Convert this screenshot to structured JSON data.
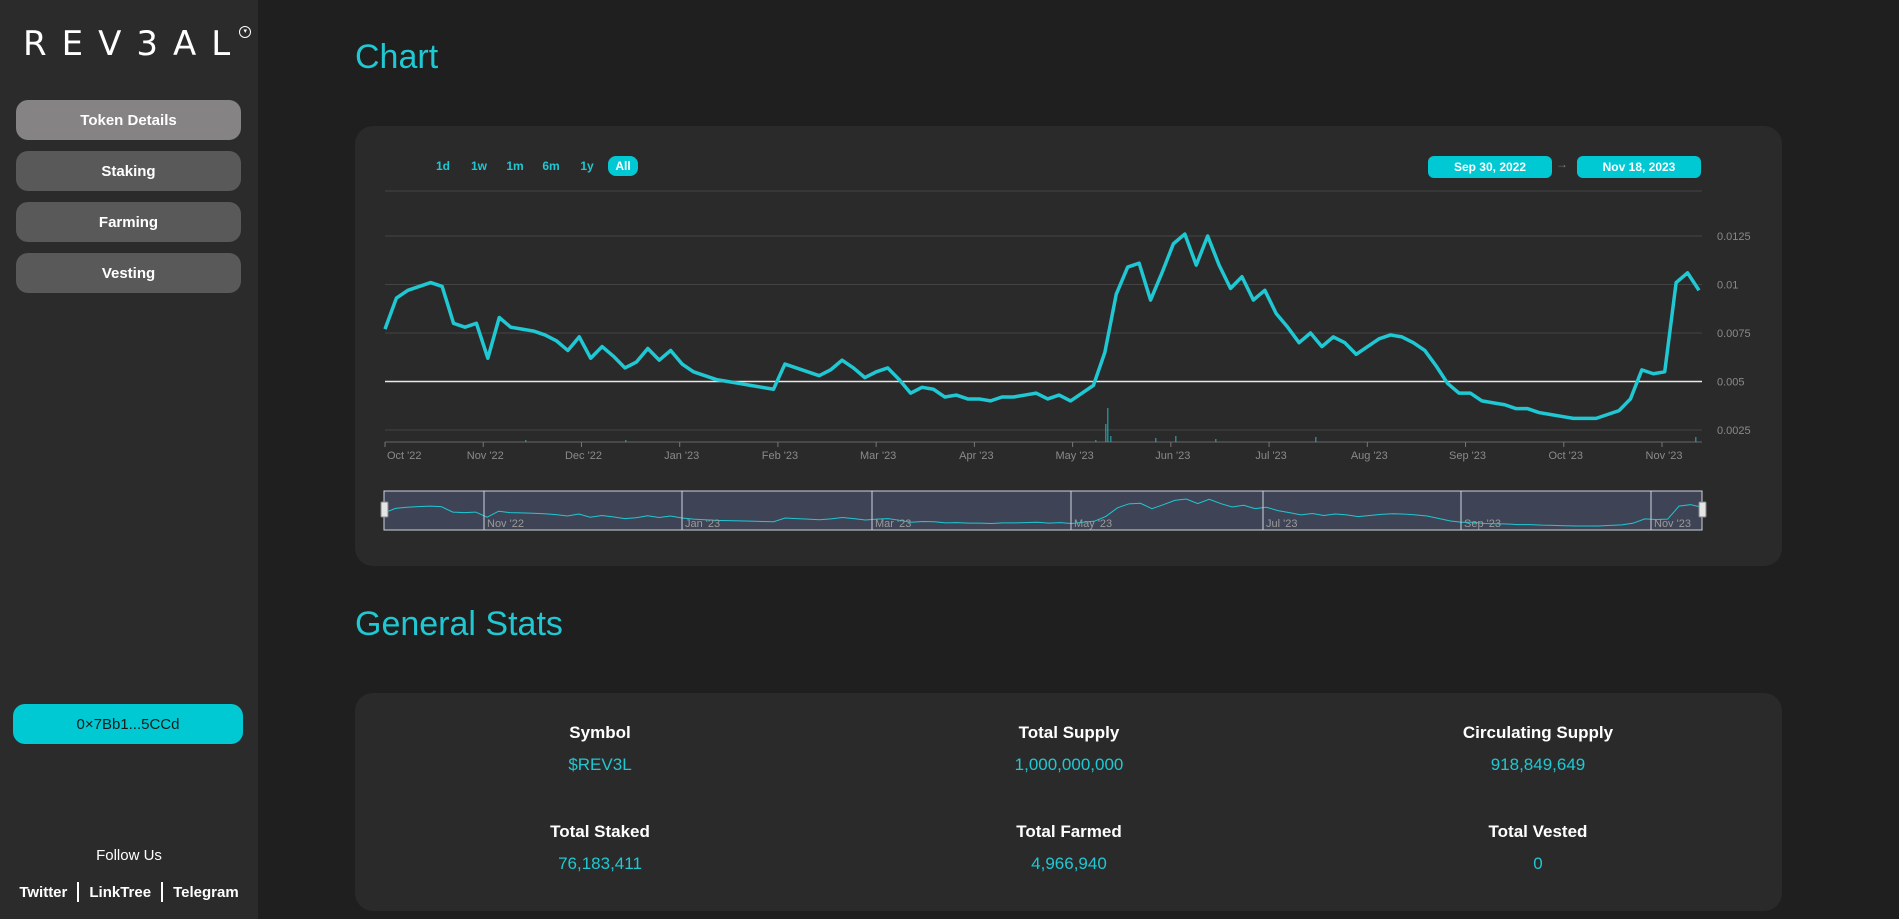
{
  "brand": {
    "logo_text": "REV3AL",
    "logo_mark": "▾"
  },
  "nav": [
    {
      "label": "Token Details",
      "active": true
    },
    {
      "label": "Staking",
      "active": false
    },
    {
      "label": "Farming",
      "active": false
    },
    {
      "label": "Vesting",
      "active": false
    }
  ],
  "wallet": {
    "address": "0×7Bb1...5CCd"
  },
  "social": {
    "heading": "Follow Us",
    "links": [
      "Twitter",
      "LinkTree",
      "Telegram"
    ]
  },
  "chart_section": {
    "title": "Chart",
    "ranges": [
      {
        "label": "1d",
        "active": false
      },
      {
        "label": "1w",
        "active": false
      },
      {
        "label": "1m",
        "active": false
      },
      {
        "label": "6m",
        "active": false
      },
      {
        "label": "1y",
        "active": false
      },
      {
        "label": "All",
        "active": true
      }
    ],
    "date_from": "Sep 30, 2022",
    "date_arrow": "→",
    "date_to": "Nov 18, 2023"
  },
  "chart_data": {
    "type": "line",
    "title": "",
    "xlabel": "",
    "ylabel": "",
    "x_tick_labels": [
      "Oct '22",
      "Nov '22",
      "Dec '22",
      "Jan '23",
      "Feb '23",
      "Mar '23",
      "Apr '23",
      "May '23",
      "Jun '23",
      "Jul '23",
      "Aug '23",
      "Sep '23",
      "Oct '23",
      "Nov '23"
    ],
    "y_tick_labels": [
      "0.0025",
      "0.005",
      "0.0075",
      "0.01",
      "0.0125"
    ],
    "ylim": [
      0.0025,
      0.0125
    ],
    "reference_line": 0.005,
    "grid": true,
    "line_color": "#1fc8d3",
    "series": [
      {
        "values": [
          0.0077,
          0.0093,
          0.0097,
          0.0099,
          0.0101,
          0.0099,
          0.008,
          0.0078,
          0.008,
          0.0062,
          0.0083,
          0.0078,
          0.0077,
          0.0076,
          0.0074,
          0.0071,
          0.0066,
          0.0073,
          0.0062,
          0.0068,
          0.0063,
          0.0057,
          0.006,
          0.0067,
          0.0061,
          0.0066,
          0.0059,
          0.0055,
          0.0053,
          0.0051,
          0.005,
          0.0049,
          0.0048,
          0.0047,
          0.0046,
          0.0059,
          0.0057,
          0.0055,
          0.0053,
          0.0056,
          0.0061,
          0.0057,
          0.0052,
          0.0055,
          0.0057,
          0.0051,
          0.0044,
          0.0047,
          0.0046,
          0.0042,
          0.0043,
          0.0041,
          0.0041,
          0.004,
          0.0042,
          0.0042,
          0.0043,
          0.0044,
          0.0041,
          0.0043,
          0.004,
          0.0044,
          0.0048,
          0.0065,
          0.0095,
          0.0109,
          0.0111,
          0.0092,
          0.0106,
          0.0121,
          0.0126,
          0.011,
          0.0125,
          0.011,
          0.0098,
          0.0104,
          0.0092,
          0.0097,
          0.0085,
          0.0078,
          0.007,
          0.0075,
          0.0068,
          0.0073,
          0.007,
          0.0064,
          0.0068,
          0.0072,
          0.0074,
          0.0073,
          0.007,
          0.0066,
          0.0058,
          0.0049,
          0.0044,
          0.0044,
          0.004,
          0.0039,
          0.0038,
          0.0036,
          0.0036,
          0.0034,
          0.0033,
          0.0032,
          0.0031,
          0.0031,
          0.0031,
          0.0033,
          0.0035,
          0.0041,
          0.0056,
          0.0054,
          0.0055,
          0.0101,
          0.0106,
          0.0097
        ]
      }
    ]
  },
  "navigator": {
    "labels": [
      "Nov '22",
      "Jan '23",
      "Mar '23",
      "May '23",
      "Jul '23",
      "Sep '23",
      "Nov '23"
    ]
  },
  "stats_section": {
    "title": "General Stats",
    "items": [
      {
        "label": "Symbol",
        "value": "$REV3L"
      },
      {
        "label": "Total Supply",
        "value": "1,000,000,000"
      },
      {
        "label": "Circulating Supply",
        "value": "918,849,649"
      },
      {
        "label": "Total Staked",
        "value": "76,183,411"
      },
      {
        "label": "Total Farmed",
        "value": "4,966,940"
      },
      {
        "label": "Total Vested",
        "value": "0"
      }
    ]
  }
}
